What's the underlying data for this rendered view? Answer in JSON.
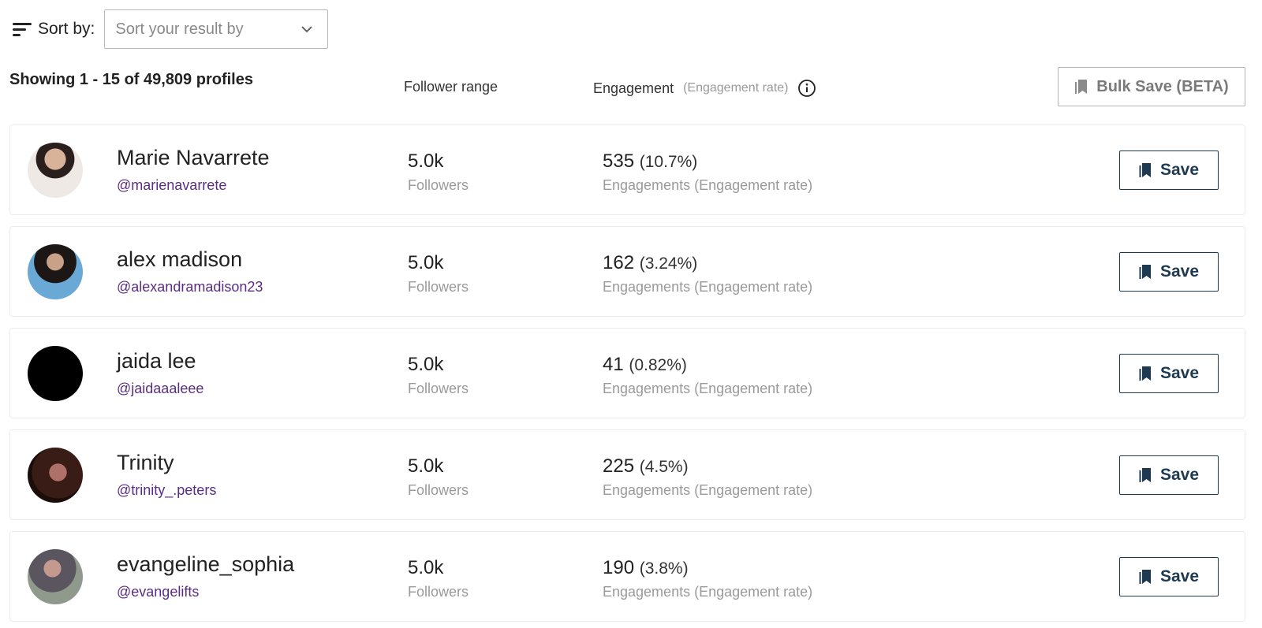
{
  "sort": {
    "label": "Sort by:",
    "placeholder": "Sort your result by"
  },
  "summary": "Showing 1 - 15 of 49,809 profiles",
  "columns": {
    "followers": "Follower range",
    "engagement": "Engagement",
    "engagement_sub": "(Engagement rate)"
  },
  "bulk_save_label": "Bulk Save (BETA)",
  "profiles": [
    {
      "name": "Marie Navarrete",
      "handle": "@marienavarrete",
      "followers": "5.0k",
      "followers_label": "Followers",
      "engagements": "535",
      "rate": "(10.7%)",
      "eng_label": "Engagements (Engagement rate)",
      "save_label": "Save"
    },
    {
      "name": "alex madison",
      "handle": "@alexandramadison23",
      "followers": "5.0k",
      "followers_label": "Followers",
      "engagements": "162",
      "rate": "(3.24%)",
      "eng_label": "Engagements (Engagement rate)",
      "save_label": "Save"
    },
    {
      "name": "jaida lee",
      "handle": "@jaidaaaleee",
      "followers": "5.0k",
      "followers_label": "Followers",
      "engagements": "41",
      "rate": "(0.82%)",
      "eng_label": "Engagements (Engagement rate)",
      "save_label": "Save"
    },
    {
      "name": "Trinity",
      "handle": "@trinity_.peters",
      "followers": "5.0k",
      "followers_label": "Followers",
      "engagements": "225",
      "rate": "(4.5%)",
      "eng_label": "Engagements (Engagement rate)",
      "save_label": "Save"
    },
    {
      "name": "evangeline_sophia",
      "handle": "@evangelifts",
      "followers": "5.0k",
      "followers_label": "Followers",
      "engagements": "190",
      "rate": "(3.8%)",
      "eng_label": "Engagements (Engagement rate)",
      "save_label": "Save"
    }
  ],
  "colors": {
    "handle": "#5a2d82",
    "save_border": "#1e3a52"
  },
  "icons": {
    "sort": "sort-lines-icon",
    "dropdown": "chevron-down-icon",
    "info": "info-icon",
    "bookmark": "bookmark-icon"
  }
}
